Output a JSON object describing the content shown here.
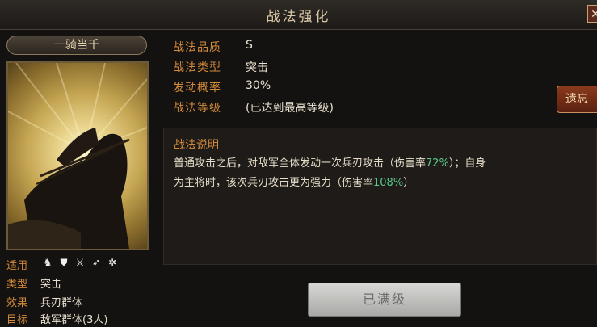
{
  "window": {
    "title": "战法强化"
  },
  "card": {
    "name": "一骑当千",
    "stats": {
      "applicable_label": "适用",
      "applicable_icons": [
        "cavalry-icon",
        "shield-icon",
        "crossed-swords-icon",
        "archer-icon",
        "siege-wheel-icon"
      ],
      "type_label": "类型",
      "type_value": "突击",
      "effect_label": "效果",
      "effect_value": "兵刃群体",
      "target_label": "目标",
      "target_value": "敌军群体(3人)"
    }
  },
  "info": {
    "quality_label": "战法品质",
    "quality_value": "S",
    "type_label": "战法类型",
    "type_value": "突击",
    "chance_label": "发动概率",
    "chance_value": "30%",
    "level_label": "战法等级",
    "level_value": "(已达到最高等级)"
  },
  "source_button": {
    "label": "遗忘"
  },
  "description": {
    "title": "战法说明",
    "line1_a": "普通攻击之后，对敌军全体发动一次兵刃攻击（伤害率",
    "line1_rate": "72%",
    "line1_b": "）；自身",
    "line2_a": "为主将时，该次兵刃攻击更为强力（伤害率",
    "line2_rate": "108%",
    "line2_b": "）"
  },
  "max_button": {
    "label": "已满级"
  },
  "colors": {
    "label_orange": "#d28a3b",
    "highlight_green": "#59c98a",
    "text_light": "#ece4d2"
  }
}
